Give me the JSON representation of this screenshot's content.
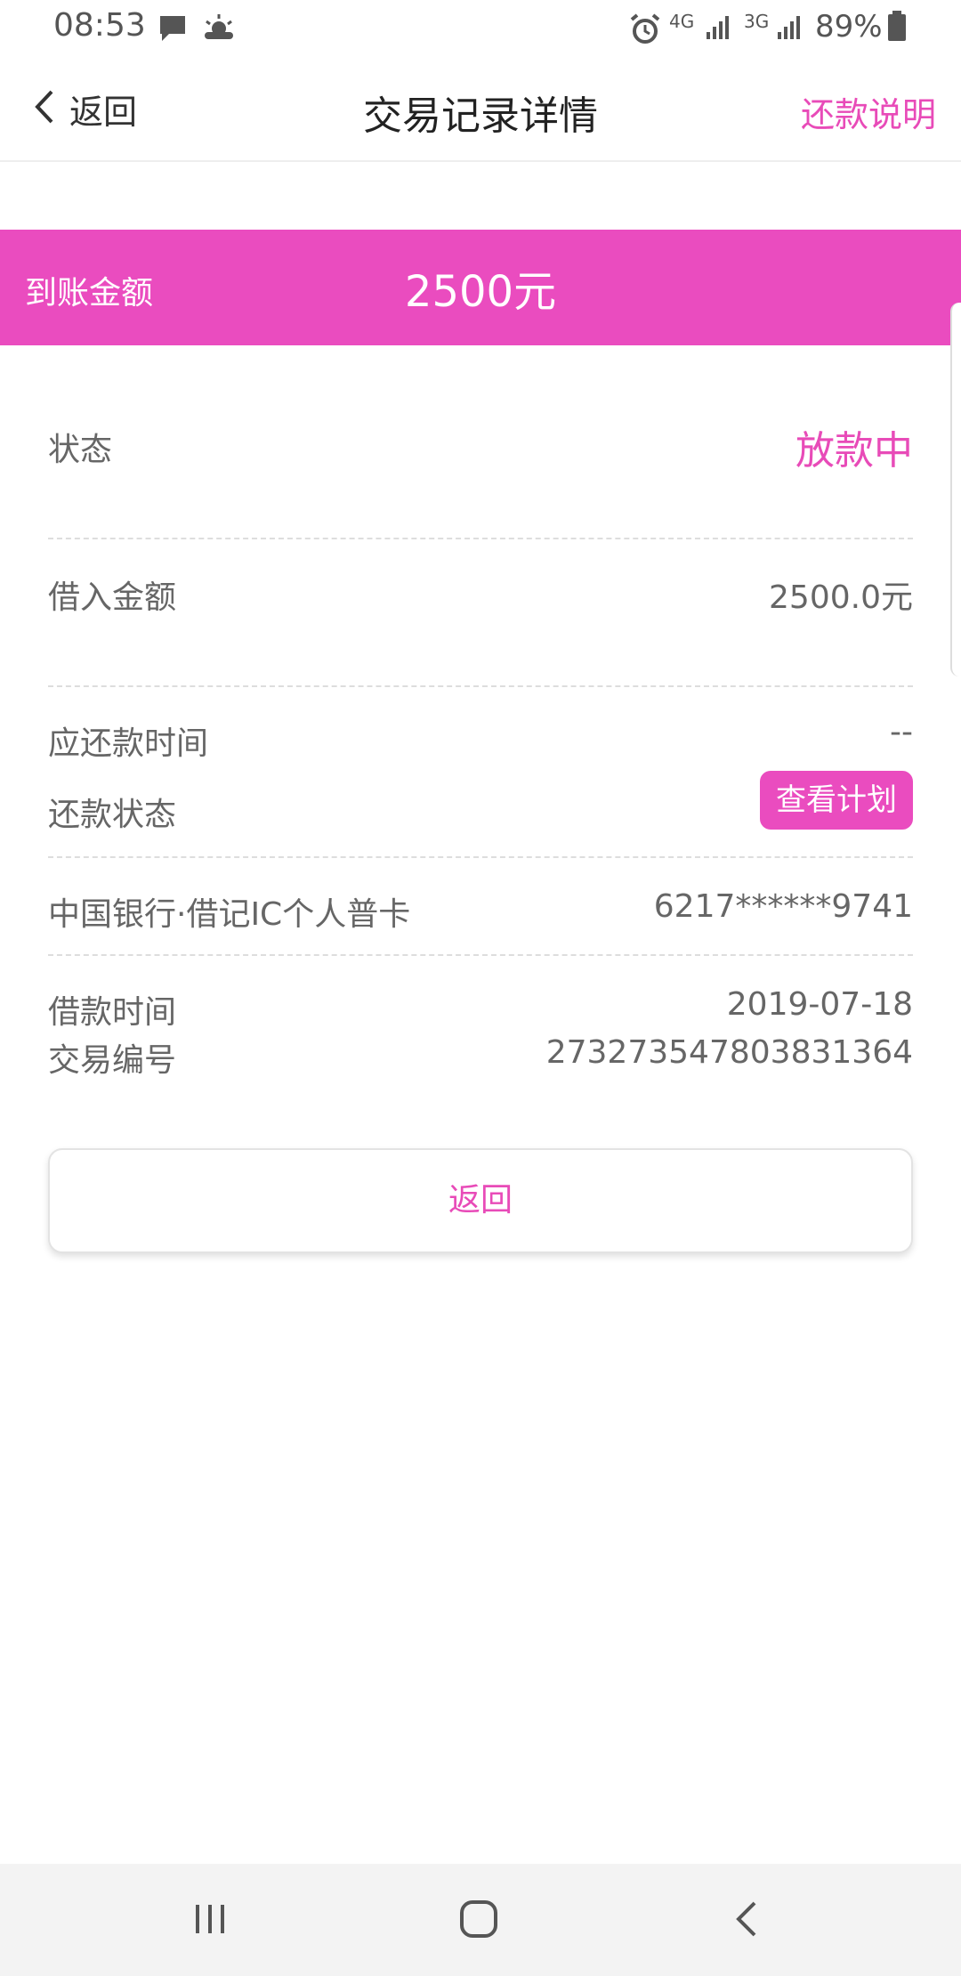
{
  "status_bar": {
    "time": "08:53",
    "net1": "4G",
    "net2": "3G",
    "battery": "89%"
  },
  "nav": {
    "back_label": "返回",
    "title": "交易记录详情",
    "right_link": "还款说明"
  },
  "banner": {
    "label": "到账金额",
    "amount": "2500元"
  },
  "details": {
    "status_label": "状态",
    "status_value": "放款中",
    "borrow_amount_label": "借入金额",
    "borrow_amount_value": "2500.0元",
    "due_time_label": "应还款时间",
    "due_time_value": "--",
    "repay_status_label": "还款状态",
    "view_plan_button": "查看计划",
    "bank_card_label": "中国银行·借记IC个人普卡",
    "bank_card_number": "6217******9741",
    "loan_time_label": "借款时间",
    "loan_time_value": "2019-07-18",
    "trade_no_label": "交易编号",
    "trade_no_value": "27327354780383136​4"
  },
  "footer": {
    "back_button": "返回"
  },
  "colors": {
    "accent": "#ea4cbf",
    "accent_text": "#e84bb8"
  },
  "icons": [
    "chevron-left-icon",
    "message-icon",
    "weather-icon",
    "alarm-icon",
    "signal-icon",
    "battery-icon",
    "recent-apps-icon",
    "home-icon",
    "back-icon"
  ]
}
